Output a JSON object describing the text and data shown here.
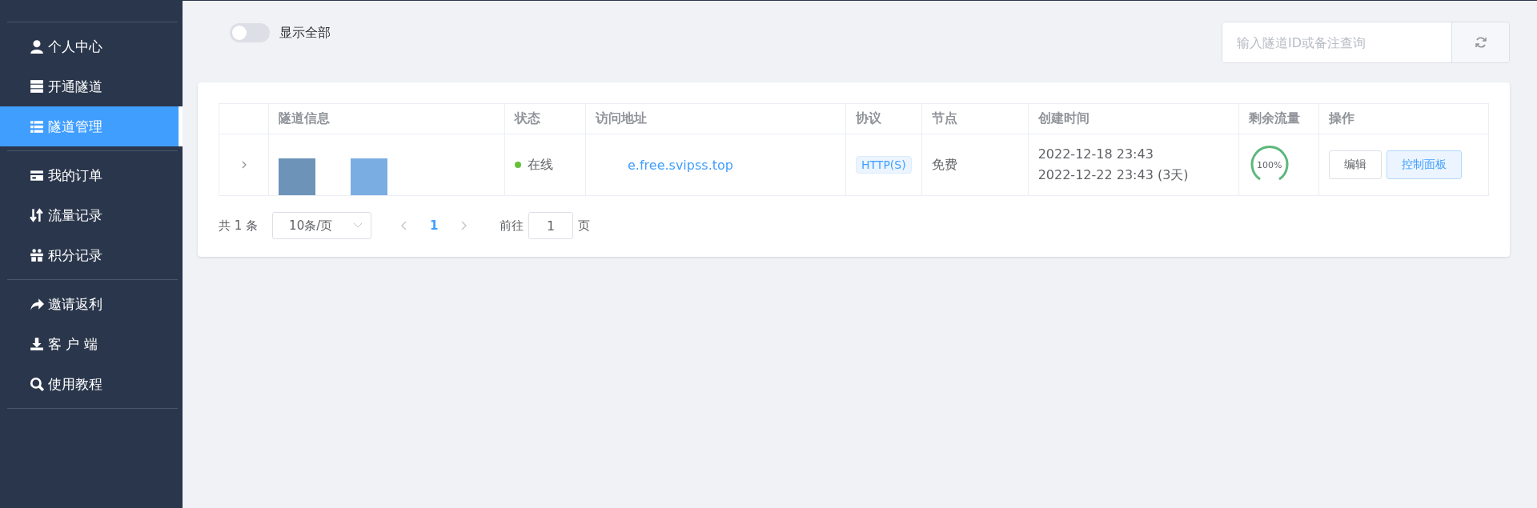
{
  "sidebar": {
    "groups": [
      {
        "items": [
          {
            "label": "个人中心",
            "selected": false
          },
          {
            "label": "开通隧道",
            "selected": false
          },
          {
            "label": "隧道管理",
            "selected": true
          }
        ]
      },
      {
        "items": [
          {
            "label": "我的订单",
            "selected": false
          },
          {
            "label": "流量记录",
            "selected": false
          },
          {
            "label": "积分记录",
            "selected": false
          }
        ]
      },
      {
        "items": [
          {
            "label": "邀请返利",
            "selected": false
          },
          {
            "label": "客 户 端",
            "selected": false
          },
          {
            "label": "使用教程",
            "selected": false
          }
        ]
      }
    ]
  },
  "toolbar": {
    "show_all": {
      "label": "显示全部",
      "on": false
    },
    "search": {
      "placeholder": "输入隧道ID或备注查询"
    }
  },
  "table": {
    "columns": [
      "隧道信息",
      "状态",
      "访问地址",
      "协议",
      "节点",
      "创建时间",
      "剩余流量",
      "操作"
    ],
    "rows": [
      {
        "expanded": false,
        "status": "在线",
        "online": true,
        "address": "e.free.svipss.top",
        "protocol": "HTTP(S)",
        "node": "免费",
        "created": "2022-12-18 23:43",
        "expires": "2022-12-22 23:43 (3天)",
        "traffic": {
          "level": 1,
          "reading": "100%"
        },
        "actions": [
          {
            "label": "编辑",
            "kind": "plain"
          },
          {
            "label": "控制面板",
            "kind": "primary"
          }
        ]
      }
    ]
  },
  "pagination": {
    "total": "共 1 条",
    "page_size": "10条/页",
    "pages": [
      {
        "label": "1",
        "selected": true
      }
    ],
    "goto_label": "前往",
    "goto_value": "1",
    "goto_suffix": "页"
  }
}
